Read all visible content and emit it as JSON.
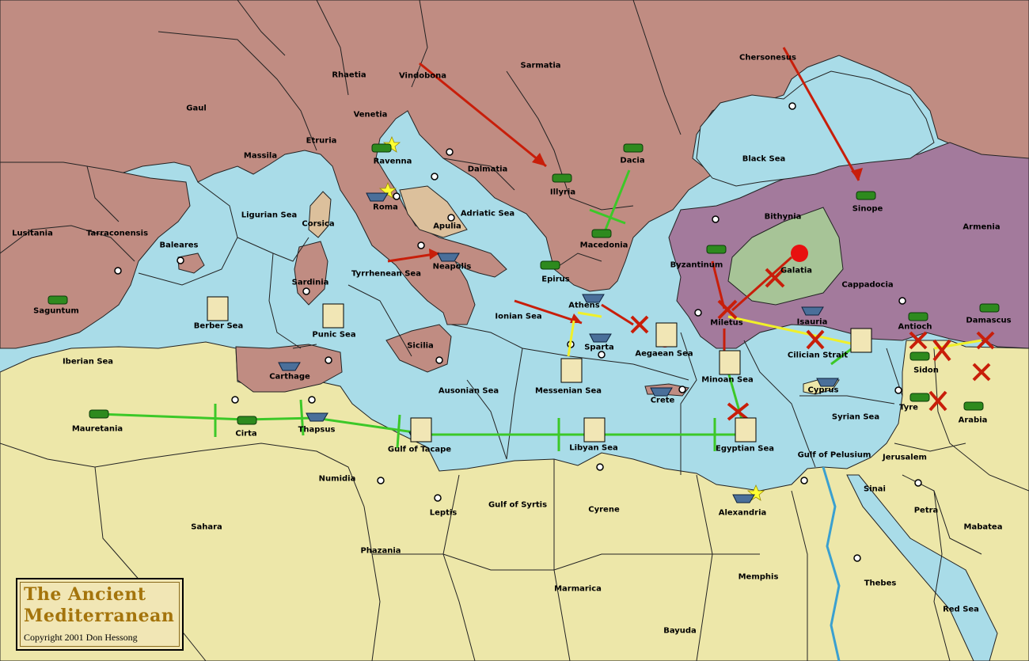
{
  "colors": {
    "sea": "#a9dce8",
    "neutral_land": "#ede7a9",
    "red_power": "#c08c82",
    "purple_power": "#a37a9c",
    "green_power": "#a7c497",
    "tan_power": "#dcc09c",
    "green_order": "#3cc828",
    "red_order": "#c81e0a",
    "yellow_order": "#f0f02a",
    "army_unit": "#2e8a1e",
    "fleet_unit": "#4a6f9a"
  },
  "legend": {
    "title_line1": "The Ancient",
    "title_line2": "Mediterranean",
    "copyright": "Copyright  2001  Don Hessong"
  },
  "territories": [
    {
      "id": "gaul",
      "label": "Gaul"
    },
    {
      "id": "rhaetia",
      "label": "Rhaetia"
    },
    {
      "id": "vindobona",
      "label": "Vindobona"
    },
    {
      "id": "sarmatia",
      "label": "Sarmatia"
    },
    {
      "id": "chersonesus",
      "label": "Chersonesus"
    },
    {
      "id": "venetia",
      "label": "Venetia"
    },
    {
      "id": "etruria",
      "label": "Etruria"
    },
    {
      "id": "massila",
      "label": "Massila"
    },
    {
      "id": "ravenna",
      "label": "Ravenna"
    },
    {
      "id": "dalmatia",
      "label": "Dalmatia"
    },
    {
      "id": "dacia",
      "label": "Dacia"
    },
    {
      "id": "illyria",
      "label": "Illyria"
    },
    {
      "id": "black-sea",
      "label": "Black Sea"
    },
    {
      "id": "lusitania",
      "label": "Lusitania"
    },
    {
      "id": "tarraconensis",
      "label": "Tarraconensis"
    },
    {
      "id": "ligurian-sea",
      "label": "Ligurian Sea"
    },
    {
      "id": "corsica",
      "label": "Corsica"
    },
    {
      "id": "roma",
      "label": "Roma"
    },
    {
      "id": "apulia",
      "label": "Apulia"
    },
    {
      "id": "adriatic-sea",
      "label": "Adriatic Sea"
    },
    {
      "id": "macedonia",
      "label": "Macedonia"
    },
    {
      "id": "bithynia",
      "label": "Bithynia"
    },
    {
      "id": "sinope",
      "label": "Sinope"
    },
    {
      "id": "armenia",
      "label": "Armenia"
    },
    {
      "id": "baleares",
      "label": "Baleares"
    },
    {
      "id": "sardinia",
      "label": "Sardinia"
    },
    {
      "id": "neapolis",
      "label": "Neapolis"
    },
    {
      "id": "tyrrhenean-sea",
      "label": "Tyrrhenean Sea"
    },
    {
      "id": "epirus",
      "label": "Epirus"
    },
    {
      "id": "byzantinum",
      "label": "Byzantinum"
    },
    {
      "id": "galatia",
      "label": "Galatia"
    },
    {
      "id": "cappadocia",
      "label": "Cappadocia"
    },
    {
      "id": "saguntum",
      "label": "Saguntum"
    },
    {
      "id": "berber-sea",
      "label": "Berber Sea"
    },
    {
      "id": "punic-sea",
      "label": "Punic Sea"
    },
    {
      "id": "athens",
      "label": "Athens"
    },
    {
      "id": "ionian-sea",
      "label": "Ionian Sea"
    },
    {
      "id": "miletus",
      "label": "Miletus"
    },
    {
      "id": "isauria",
      "label": "Isauria"
    },
    {
      "id": "antioch",
      "label": "Antioch"
    },
    {
      "id": "damascus",
      "label": "Damascus"
    },
    {
      "id": "sparta",
      "label": "Sparta"
    },
    {
      "id": "aegaean-sea",
      "label": "Aegaean Sea"
    },
    {
      "id": "sicilia",
      "label": "Sicilia"
    },
    {
      "id": "iberian-sea",
      "label": "Iberian Sea"
    },
    {
      "id": "carthage",
      "label": "Carthage"
    },
    {
      "id": "cilician-strait",
      "label": "Cilician Strait"
    },
    {
      "id": "sidon",
      "label": "Sidon"
    },
    {
      "id": "minoan-sea",
      "label": "Minoan Sea"
    },
    {
      "id": "messenian-sea",
      "label": "Messenian Sea"
    },
    {
      "id": "ausonian-sea",
      "label": "Ausonian Sea"
    },
    {
      "id": "crete",
      "label": "Crete"
    },
    {
      "id": "cyprus",
      "label": "Cyprus"
    },
    {
      "id": "tyre",
      "label": "Tyre"
    },
    {
      "id": "arabia",
      "label": "Arabia"
    },
    {
      "id": "mauretania",
      "label": "Mauretania"
    },
    {
      "id": "cirta",
      "label": "Cirta"
    },
    {
      "id": "thapsus",
      "label": "Thapsus"
    },
    {
      "id": "gulf-of-tacape",
      "label": "Gulf of Tacape"
    },
    {
      "id": "libyan-sea",
      "label": "Libyan Sea"
    },
    {
      "id": "egyptian-sea",
      "label": "Egyptian Sea"
    },
    {
      "id": "syrian-sea",
      "label": "Syrian Sea"
    },
    {
      "id": "gulf-of-pelusium",
      "label": "Gulf of Pelusium"
    },
    {
      "id": "jerusalem",
      "label": "Jerusalem"
    },
    {
      "id": "numidia",
      "label": "Numidia"
    },
    {
      "id": "sinai",
      "label": "Sinai"
    },
    {
      "id": "leptis",
      "label": "Leptis"
    },
    {
      "id": "gulf-of-syrtis",
      "label": "Gulf of Syrtis"
    },
    {
      "id": "cyrene",
      "label": "Cyrene"
    },
    {
      "id": "alexandria",
      "label": "Alexandria"
    },
    {
      "id": "petra",
      "label": "Petra"
    },
    {
      "id": "sahara",
      "label": "Sahara"
    },
    {
      "id": "mabatea",
      "label": "Mabatea"
    },
    {
      "id": "phazania",
      "label": "Phazania"
    },
    {
      "id": "memphis",
      "label": "Memphis"
    },
    {
      "id": "marmarica",
      "label": "Marmarica"
    },
    {
      "id": "thebes",
      "label": "Thebes"
    },
    {
      "id": "red-sea",
      "label": "Red Sea"
    },
    {
      "id": "bayuda",
      "label": "Bayuda"
    }
  ]
}
